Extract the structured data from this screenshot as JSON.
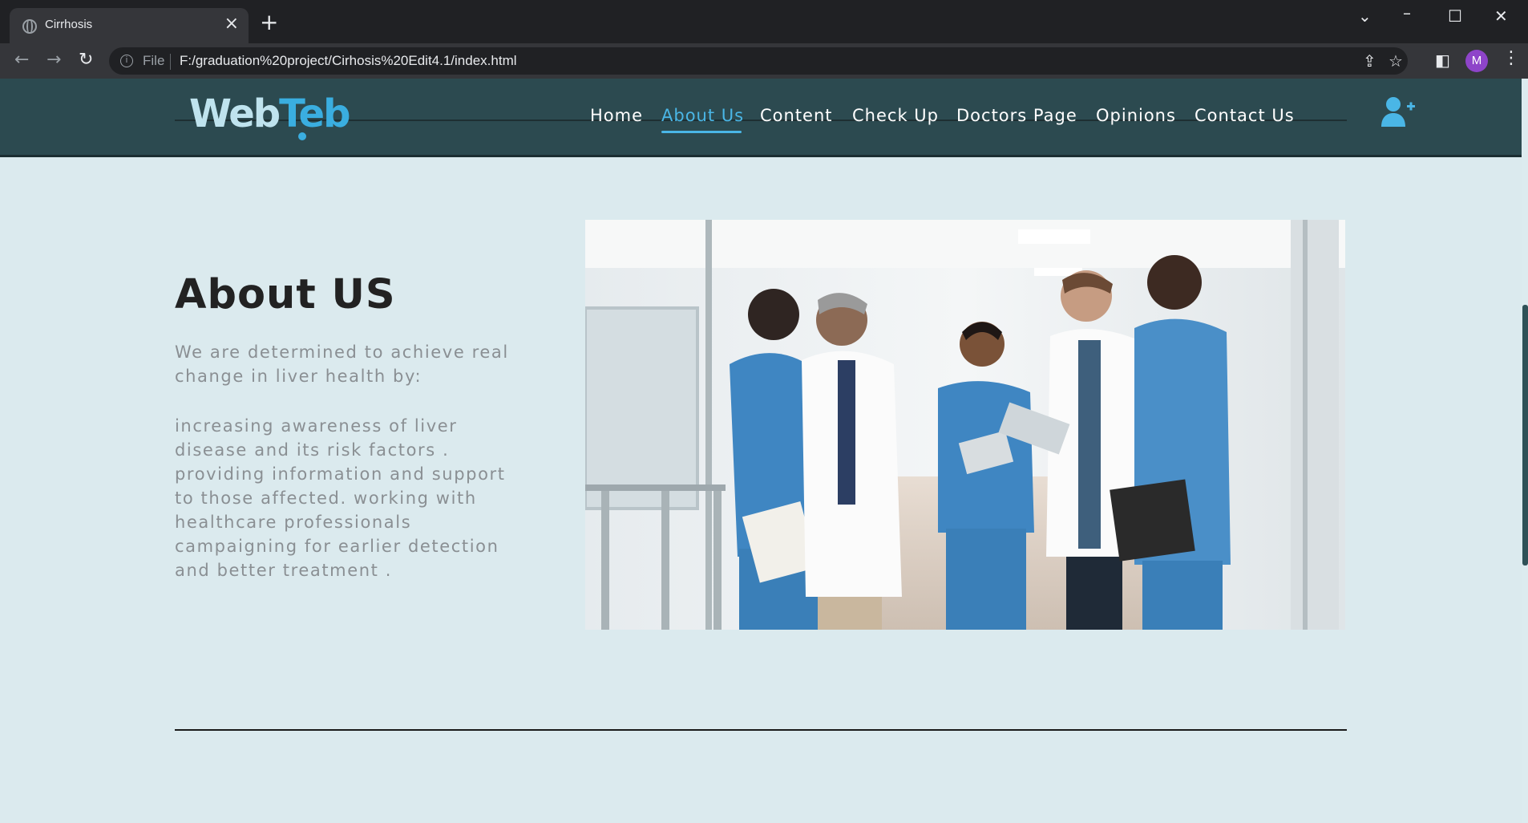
{
  "browser": {
    "tab_title": "Cirrhosis",
    "file_label": "File",
    "url": "F:/graduation%20project/Cirhosis%20Edit4.1/index.html",
    "avatar_letter": "M"
  },
  "site": {
    "logo_part1": "Web",
    "logo_part2": "Teb",
    "nav": [
      {
        "label": "Home"
      },
      {
        "label": "About Us",
        "active": true
      },
      {
        "label": "Content"
      },
      {
        "label": "Check Up"
      },
      {
        "label": "Doctors Page"
      },
      {
        "label": "Opinions"
      },
      {
        "label": "Contact Us"
      }
    ],
    "accent_color": "#4ab6e6",
    "header_color": "#2c4a50"
  },
  "about": {
    "title": "About US",
    "para1": "We are determined to achieve real change in liver health by:",
    "para2": "increasing awareness of liver disease and its risk factors . providing information and support to those affected. working with healthcare professionals campaigning for earlier detection and better treatment ."
  },
  "icons": [
    "globe-icon",
    "close-icon",
    "plus-icon",
    "back-icon",
    "forward-icon",
    "reload-icon",
    "info-icon",
    "share-icon",
    "star-icon",
    "sidepanel-icon",
    "kebab-icon",
    "user-add-icon"
  ]
}
